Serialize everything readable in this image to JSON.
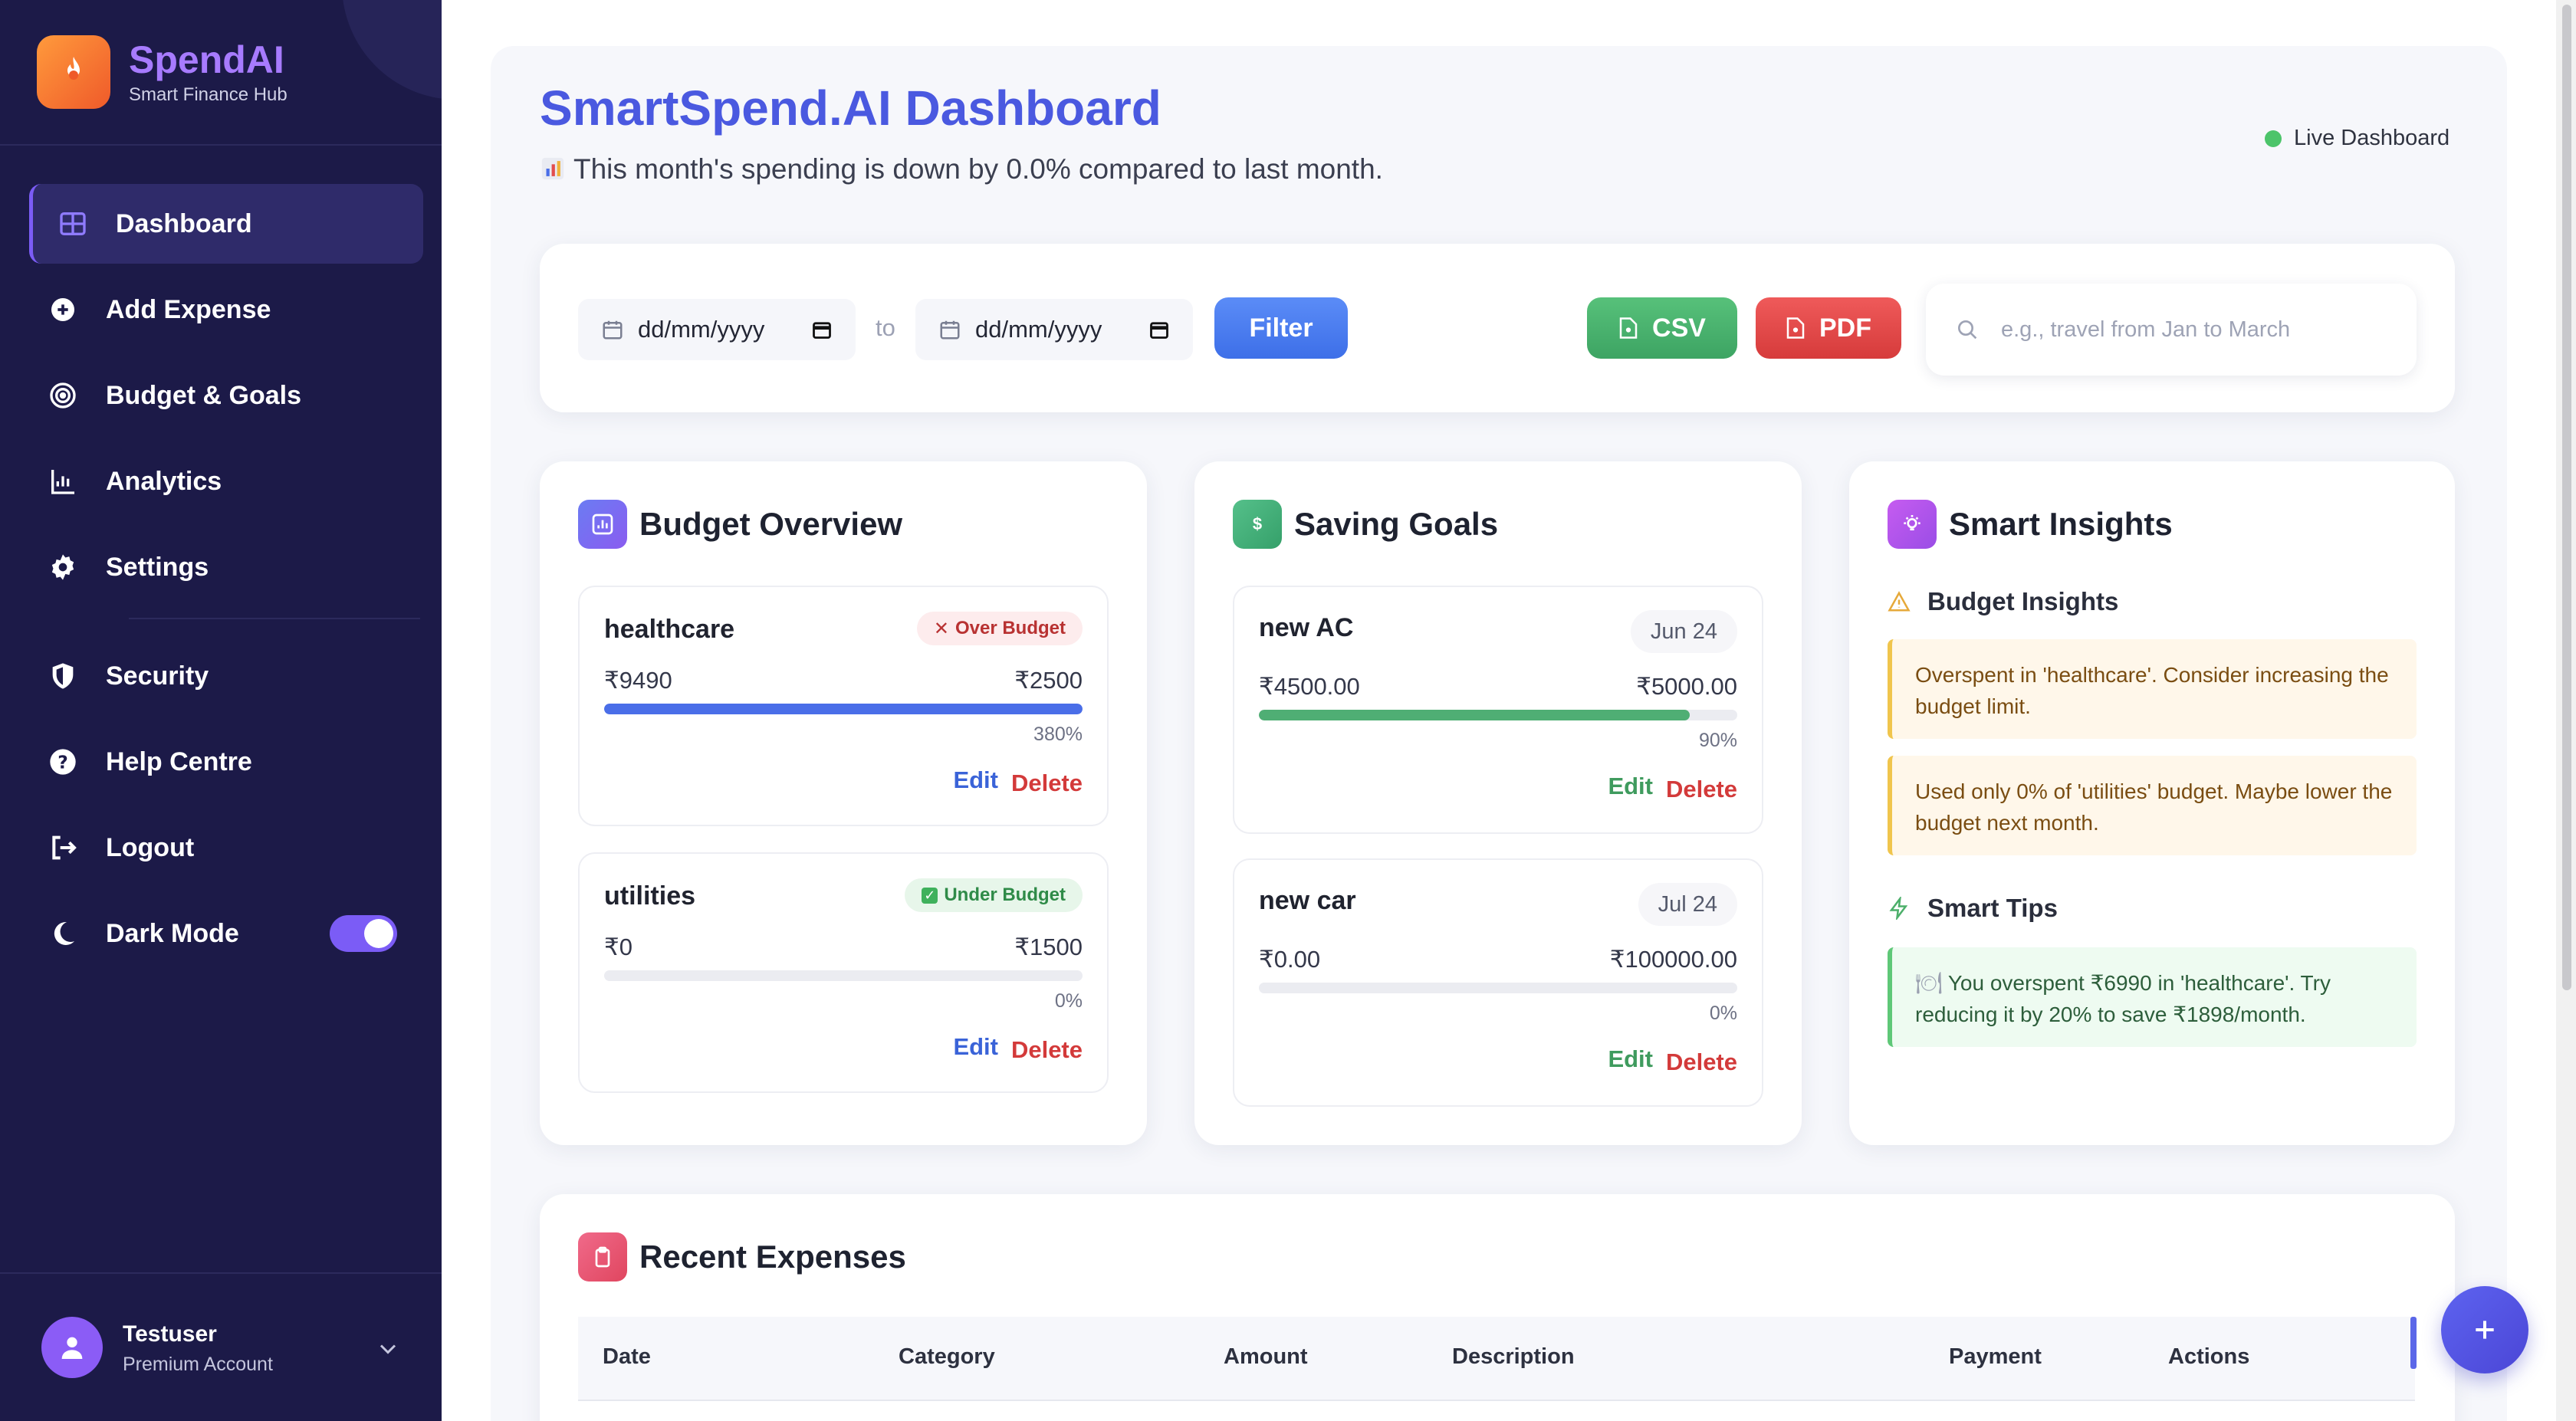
{
  "brand": {
    "name": "SpendAI",
    "subtitle": "Smart Finance Hub"
  },
  "nav": {
    "items": [
      {
        "label": "Dashboard",
        "icon": "grid-icon",
        "active": true
      },
      {
        "label": "Add Expense",
        "icon": "plus-circle-icon"
      },
      {
        "label": "Budget & Goals",
        "icon": "target-icon"
      },
      {
        "label": "Analytics",
        "icon": "bar-chart-icon"
      },
      {
        "label": "Settings",
        "icon": "gear-icon"
      }
    ],
    "items2": [
      {
        "label": "Security",
        "icon": "shield-icon"
      },
      {
        "label": "Help Centre",
        "icon": "question-icon"
      },
      {
        "label": "Logout",
        "icon": "logout-icon"
      }
    ],
    "dark_mode": {
      "label": "Dark Mode",
      "on": true
    }
  },
  "user": {
    "name": "Testuser",
    "role": "Premium Account"
  },
  "header": {
    "title": "SmartSpend.AI Dashboard",
    "subtitle": "This month's spending is down by 0.0% compared to last month.",
    "status": "Live Dashboard"
  },
  "filters": {
    "from_placeholder": "dd/mm/yyyy",
    "to_label": "to",
    "to_placeholder": "dd/mm/yyyy",
    "filter_label": "Filter",
    "csv_label": "CSV",
    "pdf_label": "PDF",
    "search_placeholder": "e.g., travel from Jan to March"
  },
  "budget": {
    "title": "Budget Overview",
    "items": [
      {
        "name": "healthcare",
        "status": "Over Budget",
        "spent": "₹9490",
        "limit": "₹2500",
        "percent": "380%",
        "progress": 1.0,
        "edit": "Edit",
        "delete": "Delete"
      },
      {
        "name": "utilities",
        "status": "Under Budget",
        "spent": "₹0",
        "limit": "₹1500",
        "percent": "0%",
        "progress": 0.0,
        "edit": "Edit",
        "delete": "Delete"
      }
    ]
  },
  "goals": {
    "title": "Saving Goals",
    "items": [
      {
        "name": "new AC",
        "date": "Jun 24",
        "saved": "₹4500.00",
        "target": "₹5000.00",
        "percent": "90%",
        "progress": 0.9,
        "edit": "Edit",
        "delete": "Delete"
      },
      {
        "name": "new car",
        "date": "Jul 24",
        "saved": "₹0.00",
        "target": "₹100000.00",
        "percent": "0%",
        "progress": 0.0,
        "edit": "Edit",
        "delete": "Delete"
      }
    ]
  },
  "insights": {
    "title": "Smart Insights",
    "budget_title": "Budget Insights",
    "budget_notes": [
      "Overspent in 'healthcare'. Consider increasing the budget limit.",
      "Used only 0% of 'utilities' budget. Maybe lower the budget next month."
    ],
    "tips_title": "Smart Tips",
    "tips": [
      "You overspent ₹6990 in 'healthcare'. Try reducing it by 20% to save ₹1898/month."
    ]
  },
  "expenses": {
    "title": "Recent Expenses",
    "columns": [
      "Date",
      "Category",
      "Amount",
      "Description",
      "Payment",
      "Actions"
    ]
  },
  "colors": {
    "sidebar": "#1c1a48",
    "accent": "#7b5cf6",
    "title_blue": "#4a59e0",
    "over_budget_bar": "#4a6ee8",
    "goal_bar": "#4fae74",
    "live_dot": "#4cc46a"
  }
}
